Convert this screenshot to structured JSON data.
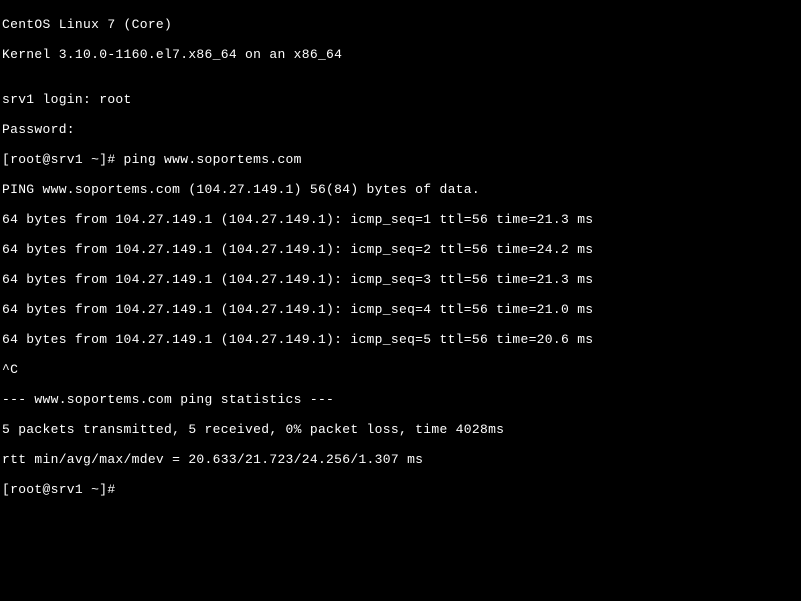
{
  "terminal": {
    "lines": [
      "CentOS Linux 7 (Core)",
      "Kernel 3.10.0-1160.el7.x86_64 on an x86_64",
      "",
      "srv1 login: root",
      "Password:",
      "[root@srv1 ~]# ping www.soportems.com",
      "PING www.soportems.com (104.27.149.1) 56(84) bytes of data.",
      "64 bytes from 104.27.149.1 (104.27.149.1): icmp_seq=1 ttl=56 time=21.3 ms",
      "64 bytes from 104.27.149.1 (104.27.149.1): icmp_seq=2 ttl=56 time=24.2 ms",
      "64 bytes from 104.27.149.1 (104.27.149.1): icmp_seq=3 ttl=56 time=21.3 ms",
      "64 bytes from 104.27.149.1 (104.27.149.1): icmp_seq=4 ttl=56 time=21.0 ms",
      "64 bytes from 104.27.149.1 (104.27.149.1): icmp_seq=5 ttl=56 time=20.6 ms",
      "^C",
      "--- www.soportems.com ping statistics ---",
      "5 packets transmitted, 5 received, 0% packet loss, time 4028ms",
      "rtt min/avg/max/mdev = 20.633/21.723/24.256/1.307 ms",
      "[root@srv1 ~]# "
    ]
  }
}
